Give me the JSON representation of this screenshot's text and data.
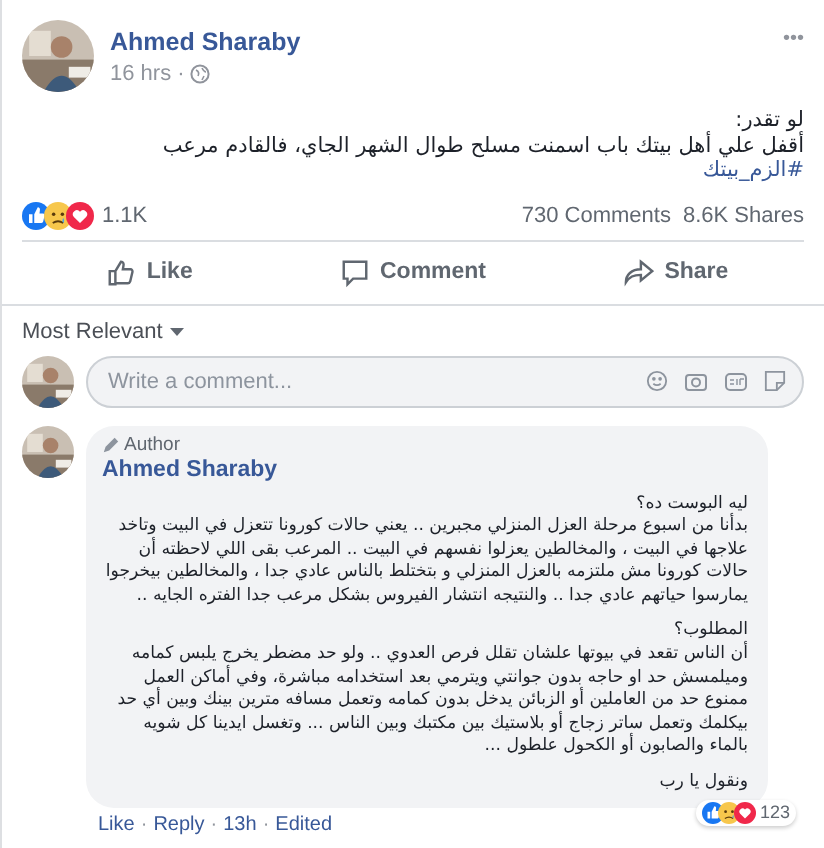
{
  "post": {
    "author": "Ahmed Sharaby",
    "time": "16 hrs",
    "separator": "·",
    "more": "•••",
    "lines": [
      "لو تقدر:",
      "أقفل علي أهل بيتك باب اسمنت مسلح طوال الشهر الجاي، فالقادم مرعب"
    ],
    "hashtag": "#الزم_بيتك"
  },
  "stats": {
    "reactions": "1.1K",
    "comments": "730 Comments",
    "shares": "8.6K Shares"
  },
  "actions": {
    "like": "Like",
    "comment": "Comment",
    "share": "Share"
  },
  "sort": {
    "label": "Most Relevant"
  },
  "composer": {
    "placeholder": "Write a comment..."
  },
  "comment": {
    "badge": "Author",
    "author": "Ahmed Sharaby",
    "paragraphs": [
      "ليه البوست ده؟\nبدأنا من اسبوع مرحلة العزل المنزلي مجبرين .. يعني حالات كورونا تتعزل في البيت وتاخد علاجها في البيت ، والمخالطين يعزلوا نفسهم في البيت .. المرعب بقى اللي لاحظته أن حالات كورونا مش ملتزمه بالعزل المنزلي و بتختلط بالناس عادي جدا ، والمخالطين بيخرجوا يمارسوا حياتهم عادي جدا .. والنتيجه انتشار الفيروس بشكل مرعب جدا الفتره الجايه ..",
      "المطلوب؟\nأن الناس تقعد في بيوتها علشان تقلل فرص العدوي .. ولو حد مضطر يخرج يلبس كمامه وميلمسش حد او حاجه بدون جوانتي ويترمي بعد استخدامه مباشرة، وفي أماكن العمل ممنوع حد من العاملين أو الزبائن يدخل بدون كمامه وتعمل مسافه مترين بينك وبين أي حد بيكلمك وتعمل ساتر زجاج أو بلاستيك بين مكتبك وبين الناس ... وتغسل ايدينا كل شويه بالماء والصابون أو الكحول علطول ...",
      "ونقول يا رب"
    ],
    "reactions": "123",
    "footer": {
      "like": "Like",
      "reply": "Reply",
      "time": "13h",
      "edited": "Edited"
    },
    "separator": "·"
  }
}
